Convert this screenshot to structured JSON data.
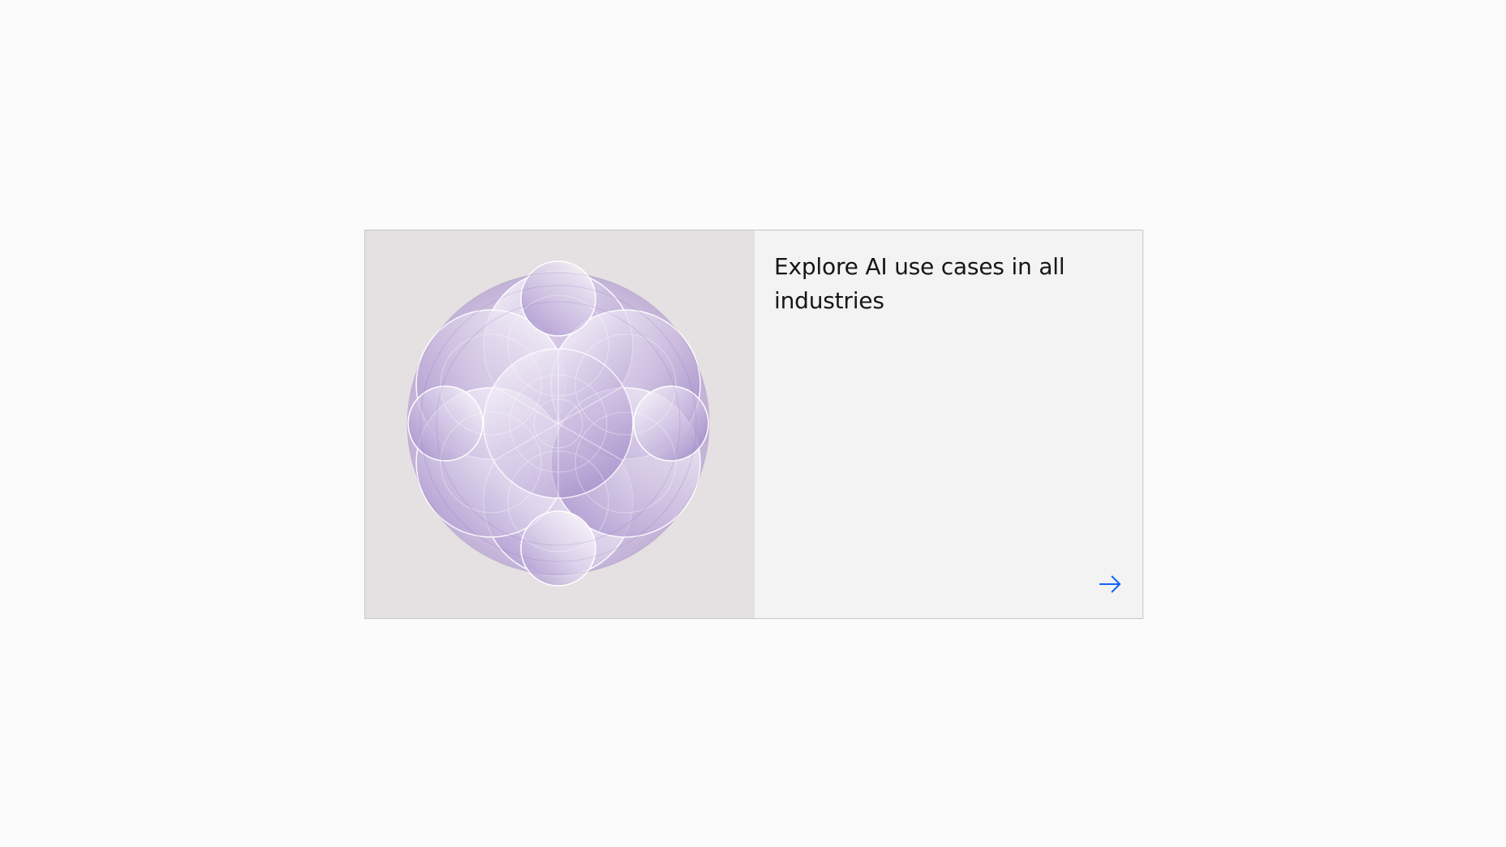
{
  "card": {
    "heading": "Explore AI use cases in all industries",
    "arrow_icon": "arrow-right-icon",
    "media_icon": "abstract-circles-artwork",
    "colors": {
      "page_background": "#fbfbfb",
      "card_background": "#f3f3f3",
      "media_background": "#e5e0e1",
      "heading_text": "#161616",
      "arrow": "#0f62fe",
      "artwork_accent": "#8b74b4"
    }
  }
}
